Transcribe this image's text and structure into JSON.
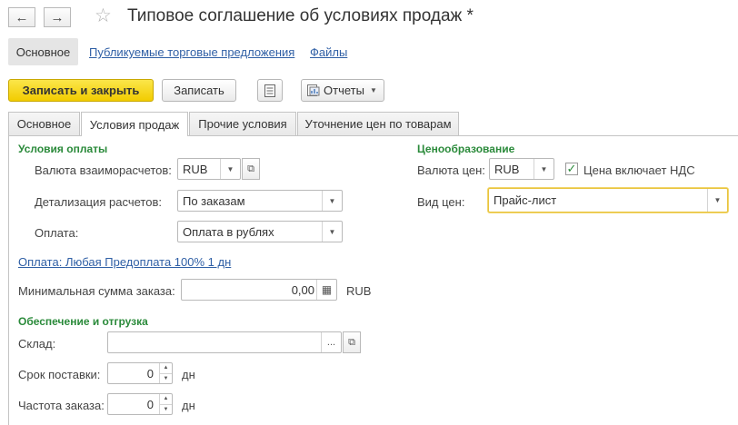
{
  "window": {
    "title": "Типовое соглашение об условиях продаж *"
  },
  "nav": {
    "back_icon": "←",
    "forward_icon": "→",
    "favorite_icon": "☆"
  },
  "sections": {
    "main": "Основное",
    "offers": "Публикуемые торговые предложения",
    "files": "Файлы"
  },
  "toolbar": {
    "save_close": "Записать и закрыть",
    "save": "Записать",
    "reports": "Отчеты"
  },
  "tabs": [
    "Основное",
    "Условия продаж",
    "Прочие условия",
    "Уточнение цен по товарам"
  ],
  "payment": {
    "group_title": "Условия оплаты",
    "currency_label": "Валюта взаиморасчетов:",
    "currency_value": "RUB",
    "detail_label": "Детализация расчетов:",
    "detail_value": "По заказам",
    "payment_label": "Оплата:",
    "payment_value": "Оплата в рублях",
    "terms_link": "Оплата: Любая Предоплата 100% 1 дн",
    "min_sum_label": "Минимальная сумма заказа:",
    "min_sum_value": "0,00",
    "min_sum_currency": "RUB"
  },
  "pricing": {
    "group_title": "Ценообразование",
    "price_currency_label": "Валюта цен:",
    "price_currency_value": "RUB",
    "vat_label": "Цена включает НДС",
    "vat_checked": true,
    "price_type_label": "Вид цен:",
    "price_type_value": "Прайс-лист"
  },
  "shipping": {
    "group_title": "Обеспечение и отгрузка",
    "warehouse_label": "Склад:",
    "warehouse_value": "",
    "delivery_label": "Срок поставки:",
    "delivery_value": "0",
    "delivery_unit": "дн",
    "frequency_label": "Частота заказа:",
    "frequency_value": "0",
    "frequency_unit": "дн"
  },
  "colors": {
    "accent_yellow": "#f2cc00",
    "group_green": "#2a8a3a",
    "link_blue": "#2f5fa5",
    "focus_border": "#e8c33d"
  },
  "icons": {
    "dropdown": "▼",
    "open": "⧉",
    "ellipsis": "...",
    "calculator": "▦",
    "spin_up": "▲",
    "spin_down": "▼",
    "check": "✓"
  }
}
